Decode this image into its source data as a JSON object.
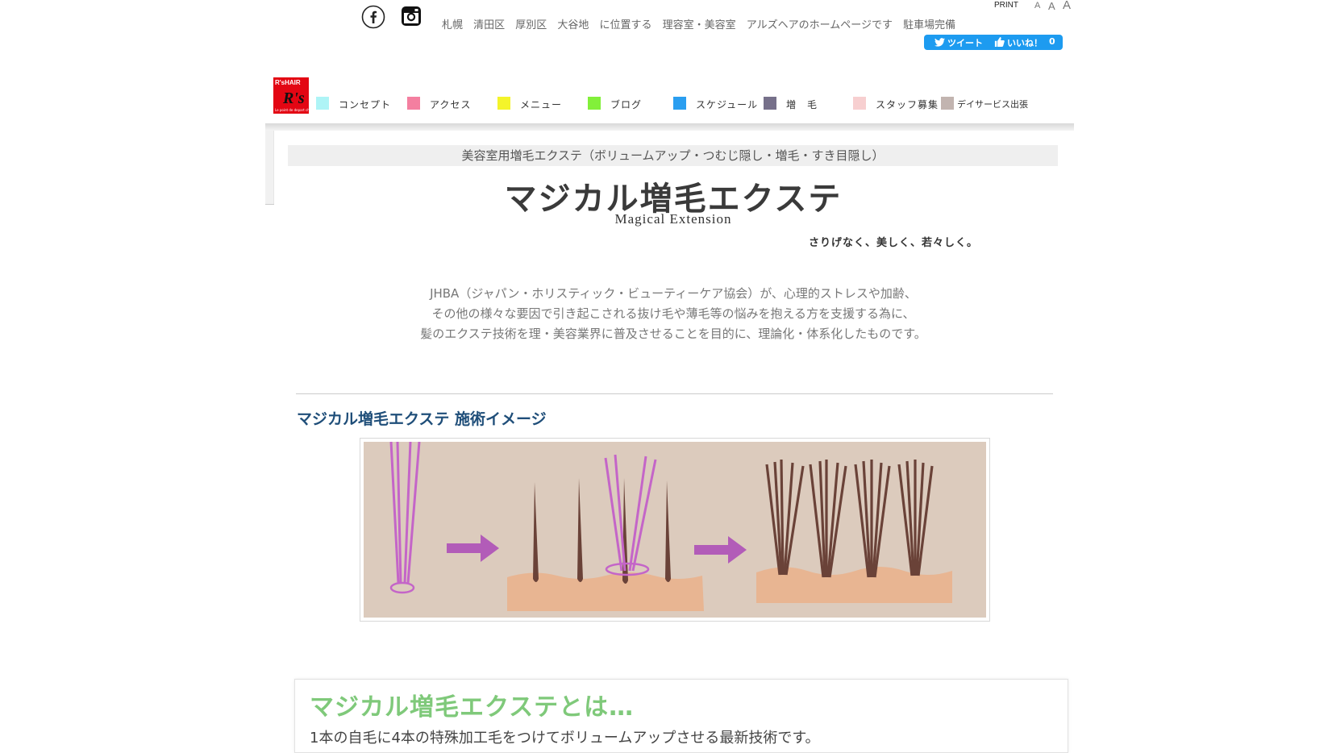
{
  "header": {
    "tagline": "札幌 清田区 厚別区 大谷地 に位置する 理容室・美容室 アルズヘアのホームページです 駐車場完備",
    "print_label": "PRINT",
    "font_sizes": [
      "A",
      "A",
      "A"
    ],
    "tweet_label": "ツイート",
    "like_label": "いいね！",
    "like_count": "0"
  },
  "logo": {
    "top_text": "R'sHAIR",
    "main_text": "R's",
    "sub_text": "Le point de depart chute"
  },
  "nav": {
    "items": [
      {
        "label": "コンセプト",
        "color": "#aef4f6"
      },
      {
        "label": "アクセス",
        "color": "#f47fa0"
      },
      {
        "label": "メニュー",
        "color": "#f4f42a"
      },
      {
        "label": "ブログ",
        "color": "#82f03a"
      },
      {
        "label": "スケジュール",
        "color": "#2a9ef0"
      },
      {
        "label": "増　毛",
        "color": "#76708a"
      },
      {
        "label": "スタッフ募集",
        "color": "#f7cfd0"
      },
      {
        "label": "デイサービス出張",
        "color": "#c2b4b0"
      }
    ]
  },
  "content": {
    "subhead": "美容室用増毛エクステ（ボリュームアップ・つむじ隠し・増毛・すき目隠し）",
    "title": "マジカル増毛エクステ",
    "title_en": "Magical Extension",
    "catch": "さりげなく、美しく、若々しく。",
    "intro": [
      "JHBA（ジャパン・ホリスティック・ビューティーケア協会）が、心理的ストレスや加齢、",
      "その他の様々な要因で引き起こされる抜け毛や薄毛等の悩みを抱える方を支援する為に、",
      "髪のエクステ技術を理・美容業界に普及させることを目的に、理論化・体系化したものです。"
    ],
    "section_title": "マジカル増毛エクステ 施術イメージ",
    "box_title": "マジカル増毛エクステとは…",
    "box_text": "1本の自毛に4本の特殊加工毛をつけてボリュームアップさせる最新技術です。"
  },
  "colors": {
    "illustration_bg": "#dccbbd",
    "skin": "#e8b592",
    "hair": "#6a4238",
    "extension": "#c465c8",
    "arrow": "#b25cb8"
  }
}
